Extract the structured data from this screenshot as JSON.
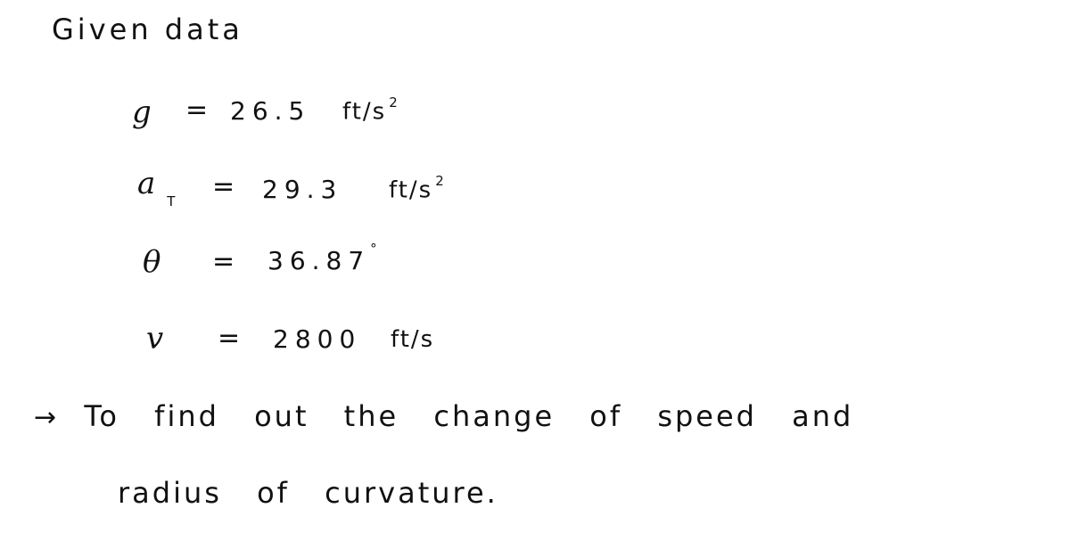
{
  "heading": "Given data",
  "given": [
    {
      "symbol": "g",
      "subscript": "",
      "equals": "=",
      "value": "26.5",
      "value_sup": "",
      "unit": "ft/s",
      "unit_sup": "2"
    },
    {
      "symbol": "a",
      "subscript": "T",
      "equals": "=",
      "value": "29.3",
      "value_sup": "",
      "unit": "ft/s",
      "unit_sup": "2"
    },
    {
      "symbol": "θ",
      "subscript": "",
      "equals": "=",
      "value": "36.87",
      "value_sup": "°",
      "unit": "",
      "unit_sup": ""
    },
    {
      "symbol": "v",
      "subscript": "",
      "equals": "=",
      "value": "2800",
      "value_sup": "",
      "unit": "ft/s",
      "unit_sup": ""
    }
  ],
  "objective": {
    "arrow": "→",
    "line1": [
      "To",
      "find",
      "out",
      "the",
      "change",
      "of",
      "speed",
      "and"
    ],
    "line2": [
      "radius",
      "of",
      "curvature."
    ]
  }
}
